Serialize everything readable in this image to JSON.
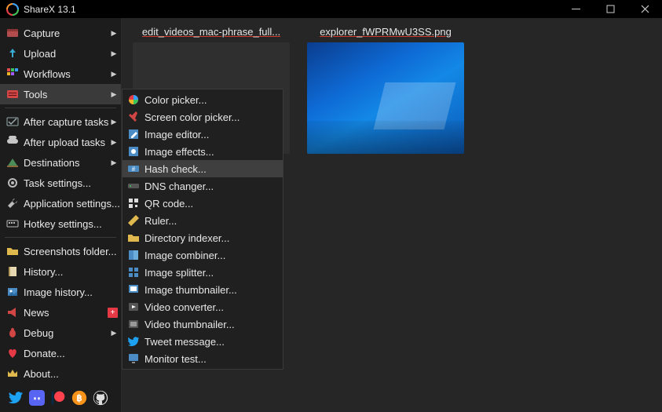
{
  "window": {
    "title": "ShareX 13.1"
  },
  "sidebar": {
    "items": [
      {
        "label": "Capture",
        "arrow": true
      },
      {
        "label": "Upload",
        "arrow": true
      },
      {
        "label": "Workflows",
        "arrow": true
      },
      {
        "label": "Tools",
        "arrow": true,
        "highlight": true
      },
      {
        "divider": true
      },
      {
        "label": "After capture tasks",
        "arrow": true
      },
      {
        "label": "After upload tasks",
        "arrow": true
      },
      {
        "label": "Destinations",
        "arrow": true
      },
      {
        "label": "Task settings..."
      },
      {
        "label": "Application settings..."
      },
      {
        "label": "Hotkey settings..."
      },
      {
        "divider": true
      },
      {
        "label": "Screenshots folder..."
      },
      {
        "label": "History..."
      },
      {
        "label": "Image history..."
      },
      {
        "label": "News",
        "badge": "+"
      },
      {
        "label": "Debug",
        "arrow": true
      },
      {
        "label": "Donate..."
      },
      {
        "label": "About..."
      }
    ]
  },
  "tools_submenu": {
    "items": [
      {
        "label": "Color picker..."
      },
      {
        "label": "Screen color picker..."
      },
      {
        "label": "Image editor..."
      },
      {
        "label": "Image effects..."
      },
      {
        "label": "Hash check...",
        "highlight": true
      },
      {
        "label": "DNS changer..."
      },
      {
        "label": "QR code..."
      },
      {
        "label": "Ruler..."
      },
      {
        "label": "Directory indexer..."
      },
      {
        "label": "Image combiner..."
      },
      {
        "label": "Image splitter..."
      },
      {
        "label": "Image thumbnailer..."
      },
      {
        "label": "Video converter..."
      },
      {
        "label": "Video thumbnailer..."
      },
      {
        "label": "Tweet message..."
      },
      {
        "label": "Monitor test..."
      }
    ]
  },
  "files": [
    {
      "caption": "edit_videos_mac-phrase_full..."
    },
    {
      "caption": "explorer_fWPRMwU3SS.png"
    }
  ],
  "icons": {
    "twitter": "twitter-icon",
    "discord": "discord-icon",
    "patreon": "patreon-icon",
    "bitcoin": "bitcoin-icon",
    "github": "github-icon"
  },
  "colors": {
    "accent_red": "#e63946",
    "bg_dark": "#1c1c1c",
    "bg_content": "#262626",
    "highlight": "#3a3a3a"
  }
}
